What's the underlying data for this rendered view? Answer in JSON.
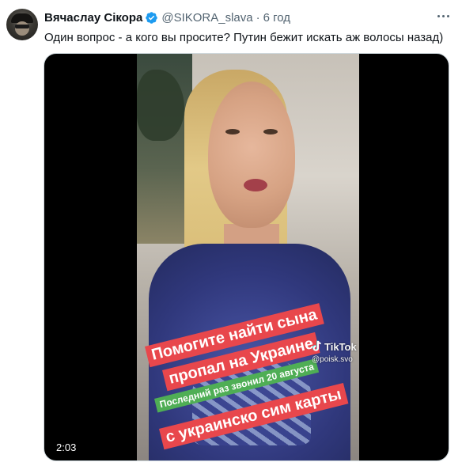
{
  "tweet": {
    "author_name": "Вячаслау Сікора",
    "handle": "@SIKORA_slava",
    "separator": "·",
    "time": "6 год",
    "text": "Один вопрос - а кого вы просите? Путин бежит искать аж волосы назад)",
    "verified": true,
    "verified_color": "#1d9bf0"
  },
  "media": {
    "video_duration": "2:03",
    "captions": [
      "Помогите найти сына",
      "пропал на Украине",
      "Последний раз звонил 20 августа",
      "с украинско сим карты"
    ],
    "watermark_brand": "TikTok",
    "watermark_handle": "@poisk.svo"
  },
  "icons": {
    "avatar": "avatar",
    "verified": "verified-badge-icon",
    "more": "more-options-icon",
    "tiktok": "tiktok-logo-icon"
  }
}
